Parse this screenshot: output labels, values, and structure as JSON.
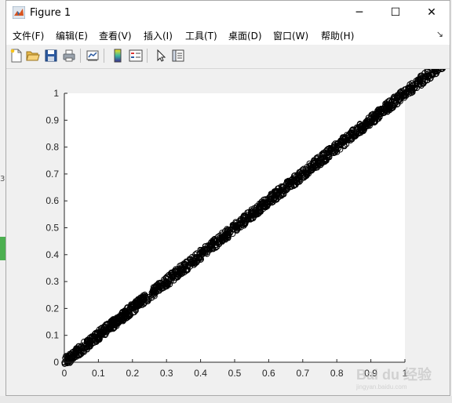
{
  "window": {
    "title": "Figure 1",
    "minimize_glyph": "─",
    "maximize_glyph": "☐",
    "close_glyph": "✕"
  },
  "menu": {
    "items": [
      {
        "label": "文件(F)"
      },
      {
        "label": "编辑(E)"
      },
      {
        "label": "查看(V)"
      },
      {
        "label": "插入(I)"
      },
      {
        "label": "工具(T)"
      },
      {
        "label": "桌面(D)"
      },
      {
        "label": "窗口(W)"
      },
      {
        "label": "帮助(H)"
      }
    ],
    "dock_arrow": "↘"
  },
  "toolbar": {
    "icons": [
      "new-figure-icon",
      "open-file-icon",
      "save-icon",
      "print-icon",
      "link-plot-icon",
      "insert-colorbar-icon",
      "insert-legend-icon",
      "pointer-icon",
      "property-editor-icon"
    ]
  },
  "background_app": {
    "left_fragment": "3"
  },
  "watermark": {
    "text": "Bai du 经验",
    "subtext": "jingyan.baidu.com"
  },
  "chart_data": {
    "type": "scatter",
    "marker": "circle",
    "color": "#000000",
    "xlim": [
      0,
      1
    ],
    "ylim": [
      0,
      1
    ],
    "xticks": [
      "0",
      "0.1",
      "0.2",
      "0.3",
      "0.4",
      "0.5",
      "0.6",
      "0.7",
      "0.8",
      "0.9",
      "1"
    ],
    "yticks": [
      "0",
      "0.1",
      "0.2",
      "0.3",
      "0.4",
      "0.5",
      "0.6",
      "0.7",
      "0.8",
      "0.9",
      "1"
    ],
    "grid": false,
    "trend": {
      "slope": 1.0,
      "intercept": 0.0
    },
    "x_span": [
      0.0,
      1.15
    ],
    "band_halfwidth": 0.02
  }
}
